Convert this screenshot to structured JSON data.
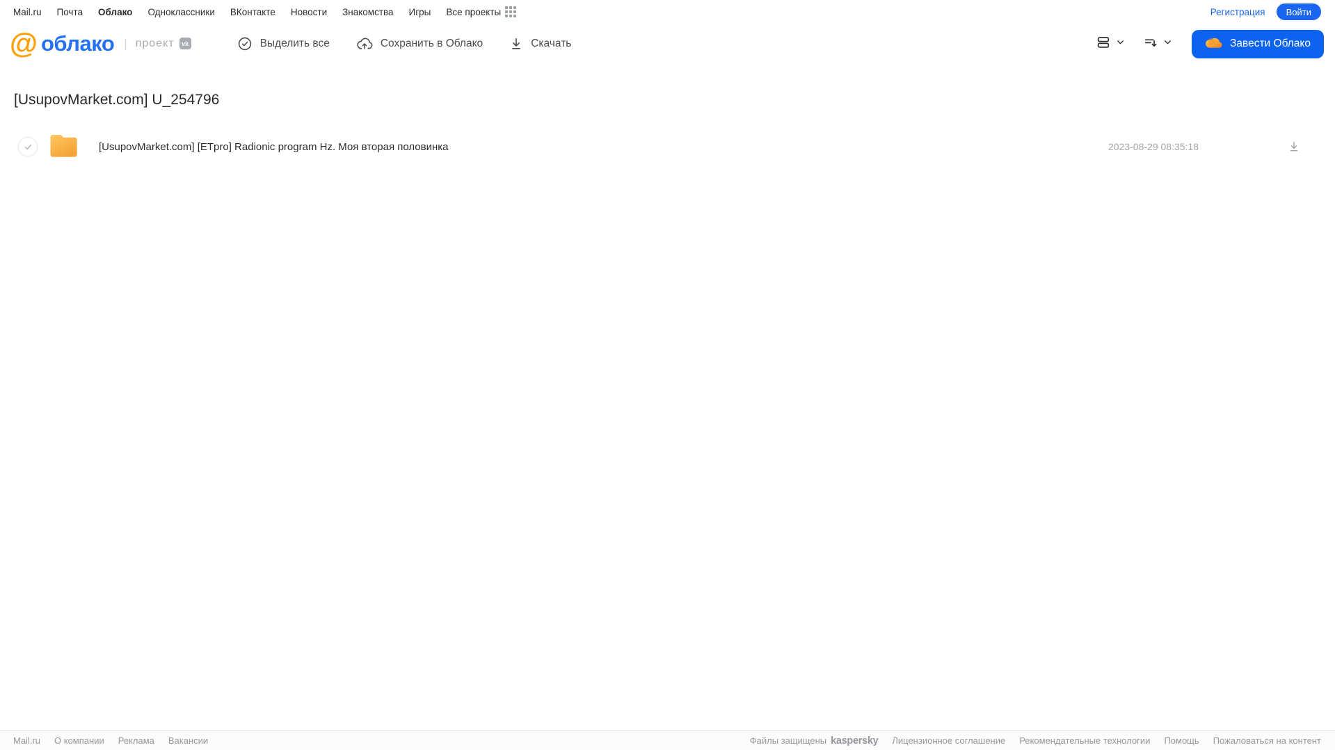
{
  "topnav": {
    "links": [
      "Mail.ru",
      "Почта",
      "Облако",
      "Одноклассники",
      "ВКонтакте",
      "Новости",
      "Знакомства",
      "Игры",
      "Все проекты"
    ],
    "active_link": "Облако",
    "register_label": "Регистрация",
    "login_label": "Войти"
  },
  "header": {
    "logo_at": "@",
    "logo_word": "облако",
    "logo_separator": "|",
    "project_label": "проект",
    "vk_badge": "vk",
    "toolbar": [
      {
        "label": "Выделить все",
        "icon": "check-circle-icon"
      },
      {
        "label": "Сохранить в Облако",
        "icon": "cloud-upload-icon"
      },
      {
        "label": "Скачать",
        "icon": "download-icon"
      }
    ],
    "cta_label": "Завести Облако"
  },
  "main": {
    "title": "[UsupovMarket.com] U_254796",
    "files": [
      {
        "name": "[UsupovMarket.com] [ETpro] Radionic program Hz. Моя вторая половинка",
        "date": "2023-08-29 08:35:18",
        "type": "folder"
      }
    ]
  },
  "footer": {
    "left_links": [
      "Mail.ru",
      "О компании",
      "Реклама",
      "Вакансии"
    ],
    "protected_text": "Файлы защищены",
    "kaspersky_label": "kaspersky",
    "right_links": [
      "Лицензионное соглашение",
      "Рекомендательные технологии",
      "Помощь",
      "Пожаловаться на контент"
    ]
  },
  "colors": {
    "accent_blue": "#0d62f0",
    "logo_blue": "#2471f2",
    "logo_orange": "#ff9e00",
    "folder_yellow": "#f7ab3f",
    "kaspersky_green": "#00a88b"
  }
}
